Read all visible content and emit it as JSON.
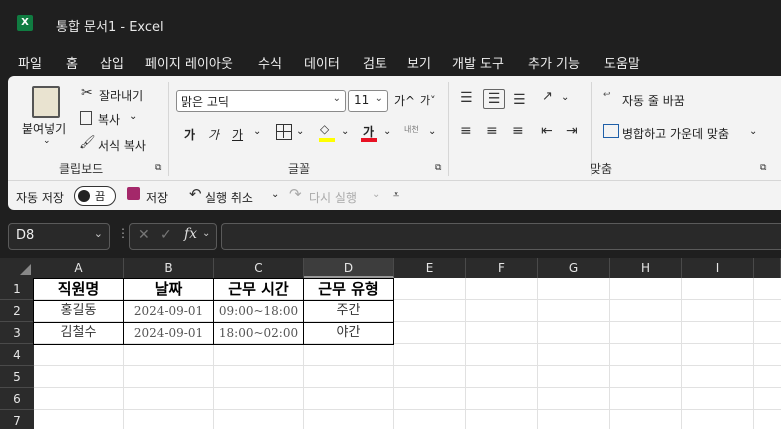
{
  "app": {
    "logo": "X",
    "title": "통합 문서1  -  Excel"
  },
  "tabs": [
    "파일",
    "홈",
    "삽입",
    "페이지 레이아웃",
    "수식",
    "데이터",
    "검토",
    "보기",
    "개발 도구",
    "추가 기능",
    "도움말"
  ],
  "ribbon": {
    "clipboard": {
      "paste": "붙여넣기",
      "cut": "잘라내기",
      "copy": "복사",
      "format_painter": "서식 복사",
      "label": "클립보드"
    },
    "font": {
      "name": "맑은 고딕",
      "size": "11",
      "grow": "가^",
      "shrink": "가˅",
      "bold": "가",
      "italic": "가",
      "underline": "가",
      "font_color": "가",
      "phonetic": "내천",
      "label": "글꼴"
    },
    "alignment": {
      "wrap": "자동 줄 바꿈",
      "merge": "병합하고 가운데 맞춤",
      "label": "맞춤"
    },
    "quick_access": {
      "autosave": "자동 저장",
      "toggle": "끔",
      "save": "저장",
      "undo": "실행 취소",
      "redo": "다시 실행"
    }
  },
  "formula_bar": {
    "name_box": "D8",
    "fx": "fx",
    "value": ""
  },
  "columns": [
    "A",
    "B",
    "C",
    "D",
    "E",
    "F",
    "G",
    "H",
    "I"
  ],
  "rows": [
    "1",
    "2",
    "3",
    "4",
    "5",
    "6",
    "7"
  ],
  "sheet": {
    "header": [
      "직원명",
      "날짜",
      "근무 시간",
      "근무 유형"
    ],
    "r2": [
      "홍길동",
      "2024-09-01",
      "09:00~18:00",
      "주간"
    ],
    "r3": [
      "김철수",
      "2024-09-01",
      "18:00~02:00",
      "야간"
    ]
  },
  "colors": {
    "accent": "#107c41",
    "font_color_bar": "#e81123",
    "highlight_bar": "#ffff00"
  }
}
